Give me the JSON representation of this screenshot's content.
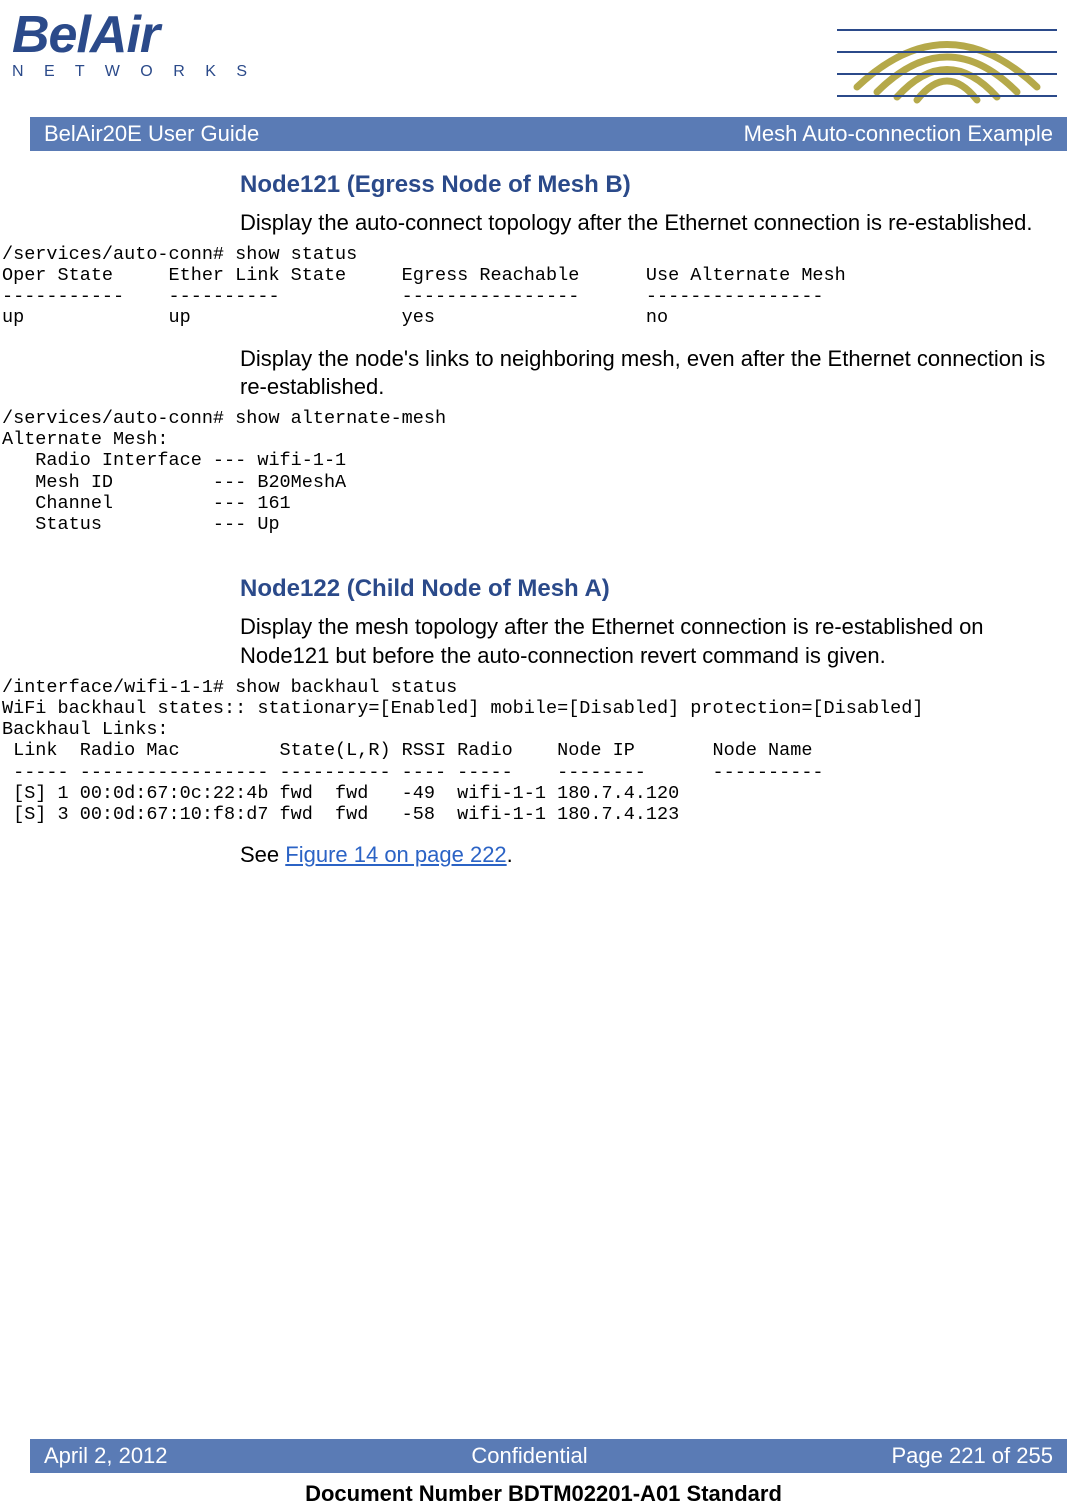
{
  "logo": {
    "main": "BelAir",
    "sub": "N E T W O R K S"
  },
  "banner": {
    "left": "BelAir20E User Guide",
    "right": "Mesh Auto-connection Example"
  },
  "sections": {
    "s1": {
      "heading": "Node121 (Egress Node of Mesh B)",
      "para1": "Display the auto-connect topology after the Ethernet connection is re-established.",
      "console1": "/services/auto-conn# show status\nOper State     Ether Link State     Egress Reachable      Use Alternate Mesh\n-----------    ----------           ----------------      ----------------\nup             up                   yes                   no",
      "para2": "Display the node's links to neighboring mesh, even after the Ethernet connection is re-established.",
      "console2": "/services/auto-conn# show alternate-mesh\nAlternate Mesh:\n   Radio Interface --- wifi-1-1\n   Mesh ID         --- B20MeshA\n   Channel         --- 161\n   Status          --- Up"
    },
    "s2": {
      "heading": "Node122 (Child Node of Mesh A)",
      "para1": "Display the mesh topology after the Ethernet connection is re-established on Node121 but before the auto-connection revert command is given.",
      "console1": "/interface/wifi-1-1# show backhaul status\nWiFi backhaul states:: stationary=[Enabled] mobile=[Disabled] protection=[Disabled]\nBackhaul Links:\n Link  Radio Mac         State(L,R) RSSI Radio    Node IP       Node Name\n ----- ----------------- ---------- ---- -----    --------      ----------\n [S] 1 00:0d:67:0c:22:4b fwd  fwd   -49  wifi-1-1 180.7.4.120\n [S] 3 00:0d:67:10:f8:d7 fwd  fwd   -58  wifi-1-1 180.7.4.123",
      "see_pre": "See ",
      "see_link": "Figure 14 on page 222",
      "see_post": "."
    }
  },
  "footer": {
    "left": "April 2, 2012",
    "center": "Confidential",
    "right": "Page 221 of 255"
  },
  "docnum": "Document Number BDTM02201-A01 Standard"
}
